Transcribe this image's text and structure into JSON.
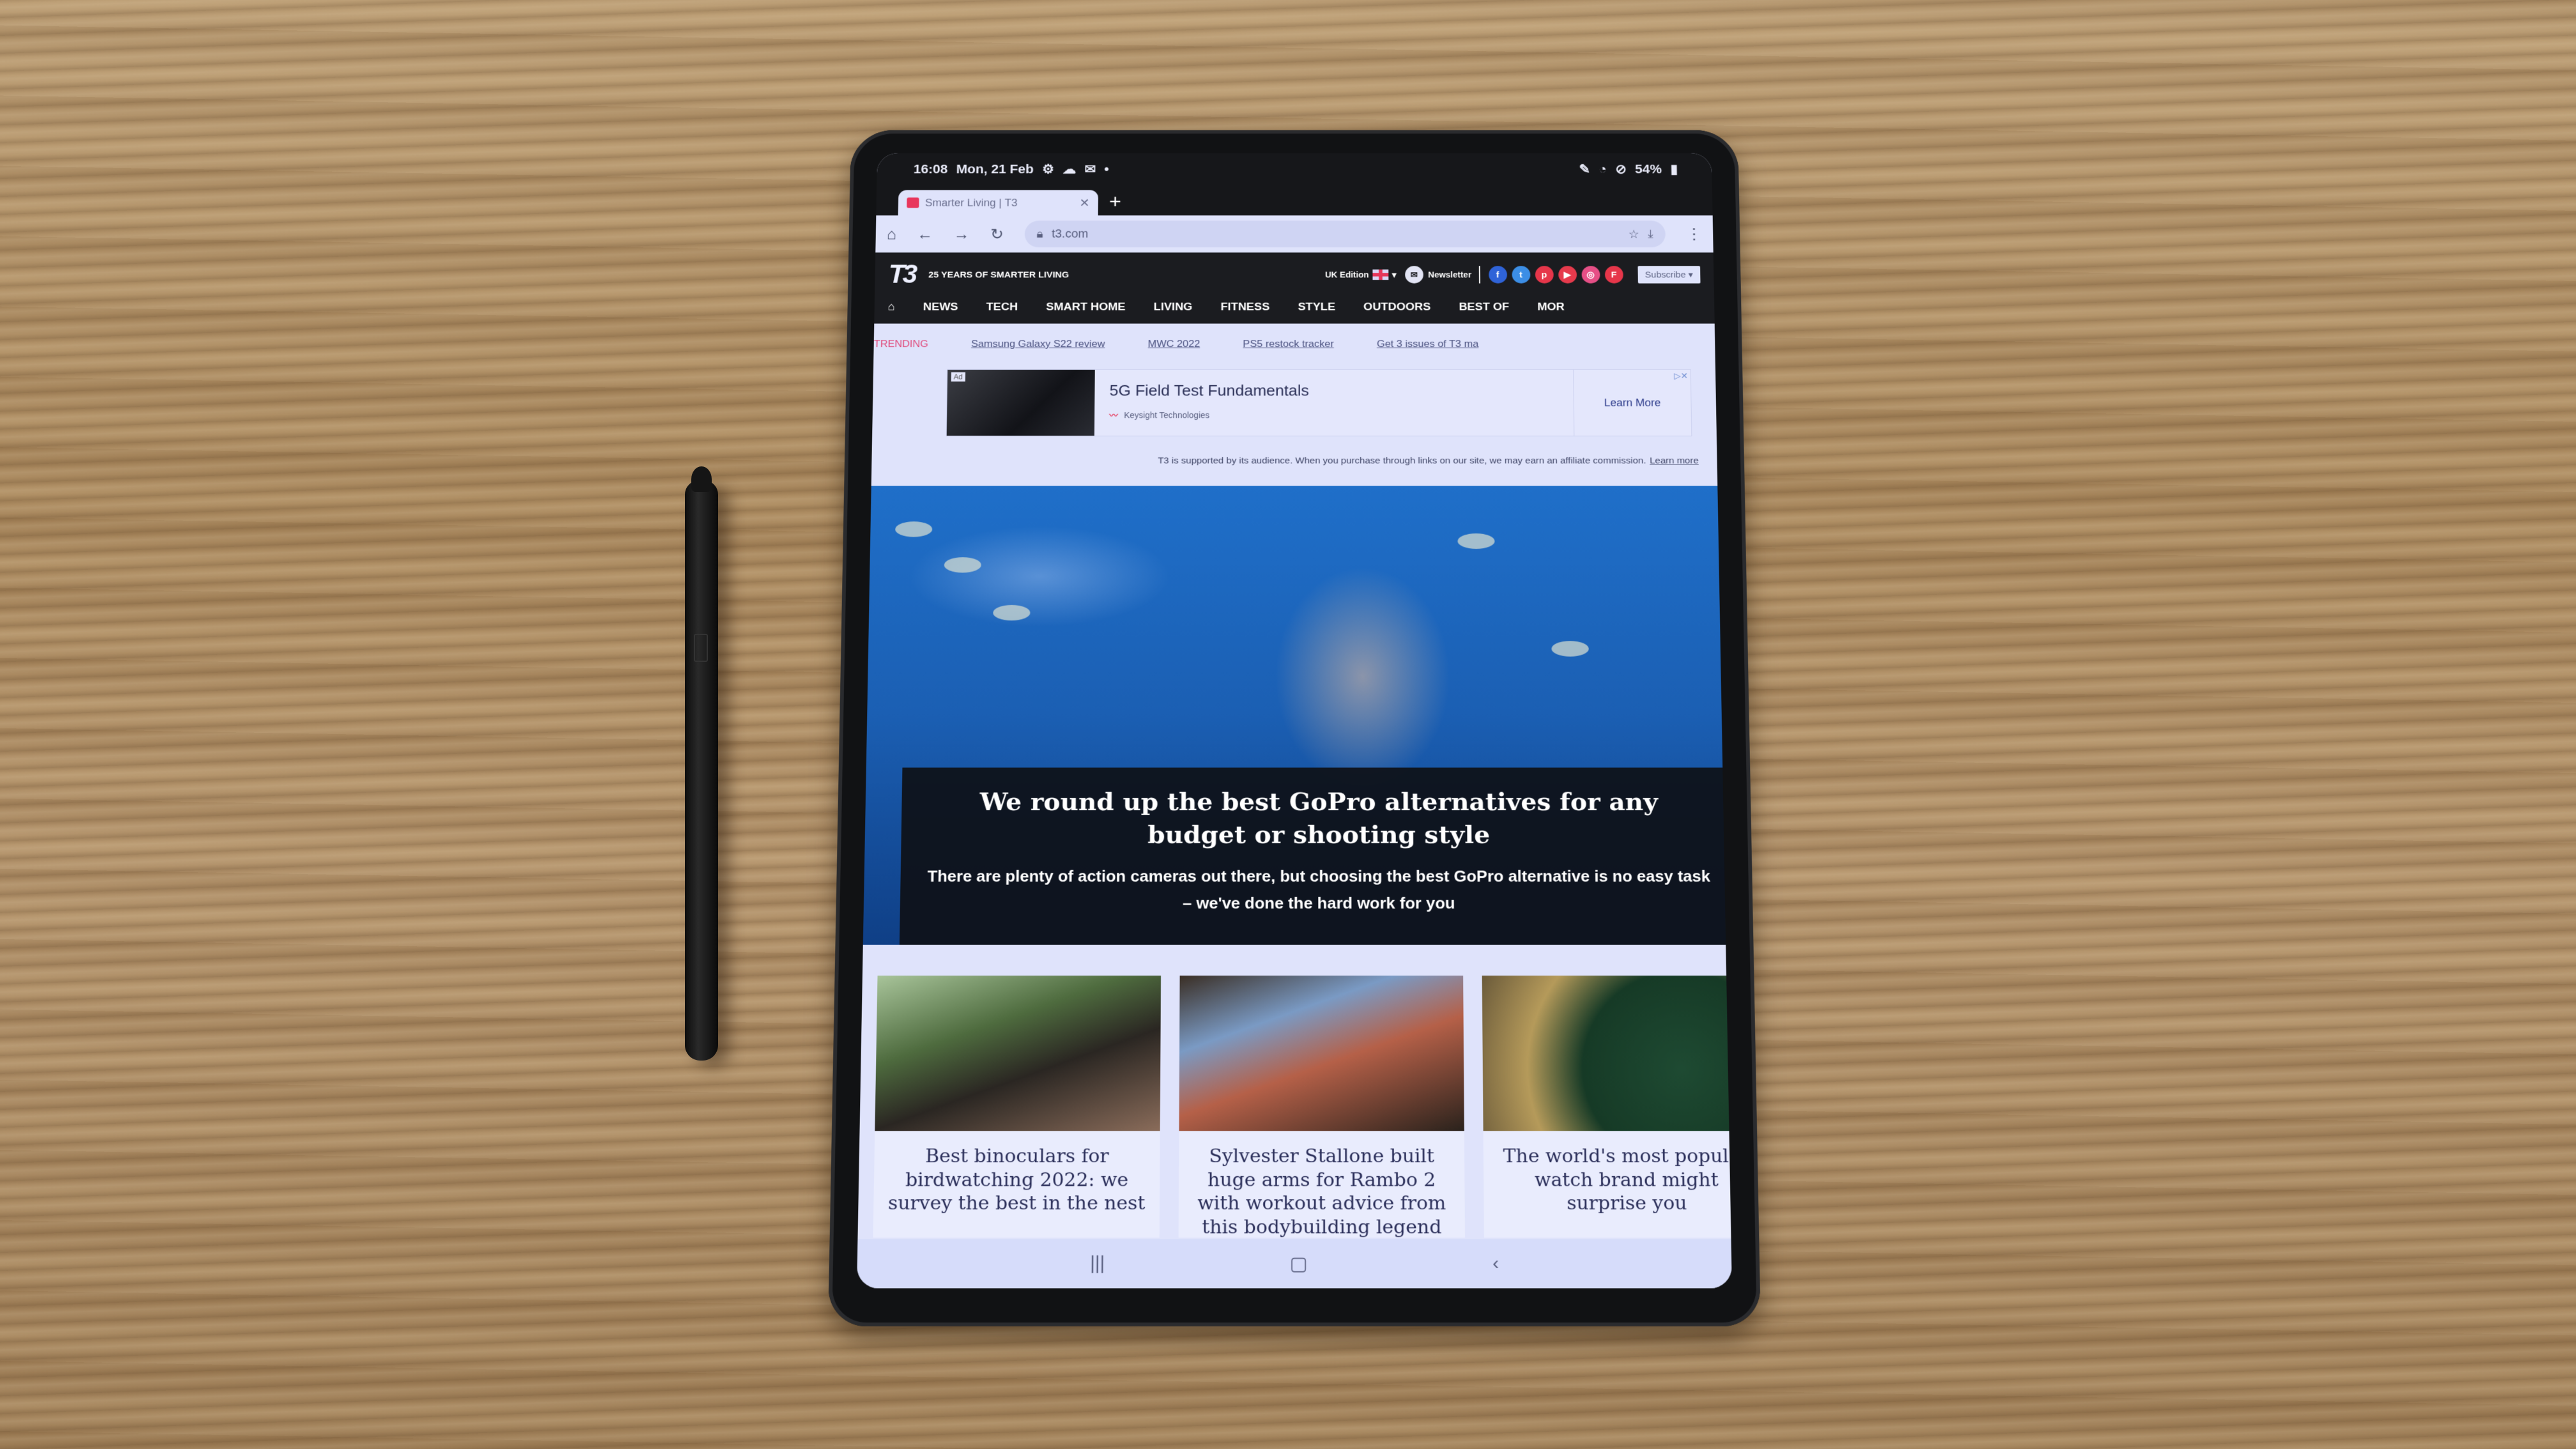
{
  "status_bar": {
    "time": "16:08",
    "date": "Mon, 21 Feb",
    "left_icons": [
      "settings-icon",
      "cloud-icon",
      "mail-icon",
      "dot-icon"
    ],
    "right_icons": [
      "pen-icon",
      "wifi-icon",
      "dnd-icon"
    ],
    "battery": "54%"
  },
  "browser": {
    "tab_title": "Smarter Living | T3",
    "new_tab_label": "+",
    "url": "t3.com"
  },
  "site": {
    "logo": "T3",
    "tagline": "25 YEARS OF SMARTER LIVING",
    "edition": "UK Edition",
    "newsletter": "Newsletter",
    "social": [
      {
        "name": "facebook",
        "glyph": "f",
        "color": "#2f63d8"
      },
      {
        "name": "twitter",
        "glyph": "t",
        "color": "#3c8ee6"
      },
      {
        "name": "pinterest",
        "glyph": "p",
        "color": "#e6364a"
      },
      {
        "name": "youtube",
        "glyph": "▶",
        "color": "#e63a4c"
      },
      {
        "name": "instagram",
        "glyph": "◎",
        "color": "#e64f86"
      },
      {
        "name": "flipboard",
        "glyph": "F",
        "color": "#e6364a"
      }
    ],
    "subscribe": "Subscribe ▾",
    "nav": [
      "NEWS",
      "TECH",
      "SMART HOME",
      "LIVING",
      "FITNESS",
      "STYLE",
      "OUTDOORS",
      "BEST OF",
      "MOR"
    ]
  },
  "trending": {
    "label": "TRENDING",
    "links": [
      "Samsung Galaxy S22 review",
      "MWC 2022",
      "PS5 restock tracker",
      "Get 3 issues of T3 ma"
    ]
  },
  "ad": {
    "badge": "Ad",
    "title": "5G Field Test Fundamentals",
    "sponsor": "Keysight Technologies",
    "cta": "Learn More",
    "close": "▷✕"
  },
  "affiliate": {
    "text": "T3 is supported by its audience. When you purchase through links on our site, we may earn an affiliate commission.",
    "link": "Learn more"
  },
  "hero": {
    "title": "We round up the best GoPro alternatives for any budget or shooting style",
    "subtitle": "There are plenty of action cameras out there, but choosing the best GoPro alternative is no easy task – we've done the hard work for you"
  },
  "cards": [
    {
      "title": "Best binoculars for birdwatching 2022: we survey the best in the nest"
    },
    {
      "title": "Sylvester Stallone built huge arms for Rambo 2 with workout advice from this bodybuilding legend"
    },
    {
      "title": "The world's most popular watch brand might surprise you"
    }
  ],
  "system_nav": {
    "recents": "|||",
    "home": "▢",
    "back": "‹"
  }
}
